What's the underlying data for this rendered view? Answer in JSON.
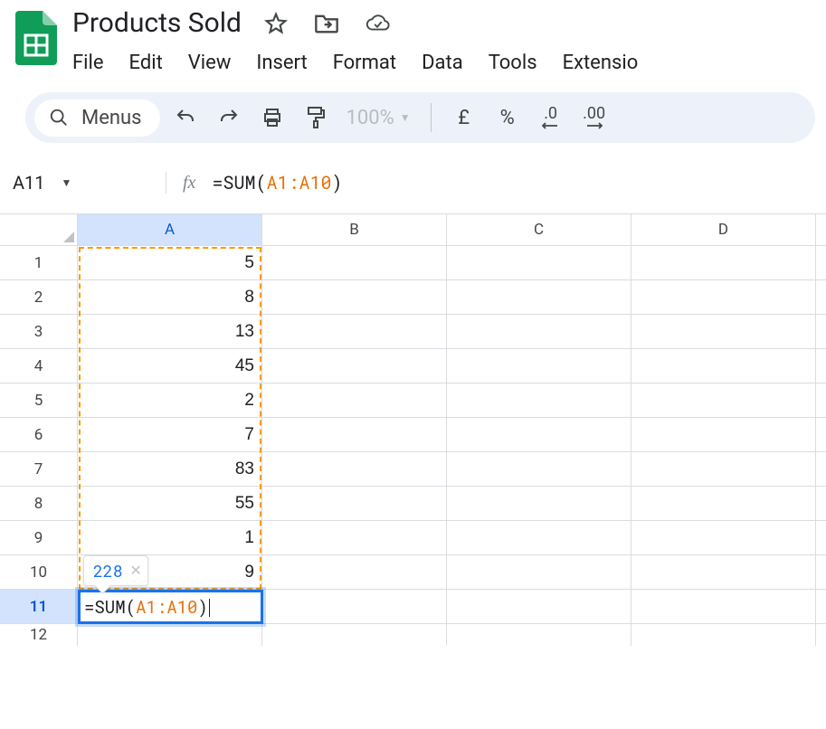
{
  "doc": {
    "title": "Products Sold"
  },
  "menubar": {
    "file": "File",
    "edit": "Edit",
    "view": "View",
    "insert": "Insert",
    "format": "Format",
    "data": "Data",
    "tools": "Tools",
    "extensions": "Extensio"
  },
  "toolbar": {
    "menus": "Menus",
    "zoom": "100%",
    "currency": "£",
    "percent": "%",
    "dec_dec": ".0",
    "dec_inc": ".00"
  },
  "namebox": {
    "cell": "A11"
  },
  "formula": {
    "prefix": "=SUM(",
    "range": "A1:A10",
    "suffix": ")"
  },
  "columns": [
    "A",
    "B",
    "C",
    "D"
  ],
  "rows": [
    {
      "n": "1",
      "a": "5"
    },
    {
      "n": "2",
      "a": "8"
    },
    {
      "n": "3",
      "a": "13"
    },
    {
      "n": "4",
      "a": "45"
    },
    {
      "n": "5",
      "a": "2"
    },
    {
      "n": "6",
      "a": "7"
    },
    {
      "n": "7",
      "a": "83"
    },
    {
      "n": "8",
      "a": "55"
    },
    {
      "n": "9",
      "a": "1"
    },
    {
      "n": "10",
      "a": "9"
    },
    {
      "n": "11",
      "a": ""
    },
    {
      "n": "12",
      "a": ""
    }
  ],
  "edit": {
    "prefix": "=SUM(",
    "range": "A1:A10",
    "suffix": ")"
  },
  "tooltip": {
    "value": "228"
  }
}
